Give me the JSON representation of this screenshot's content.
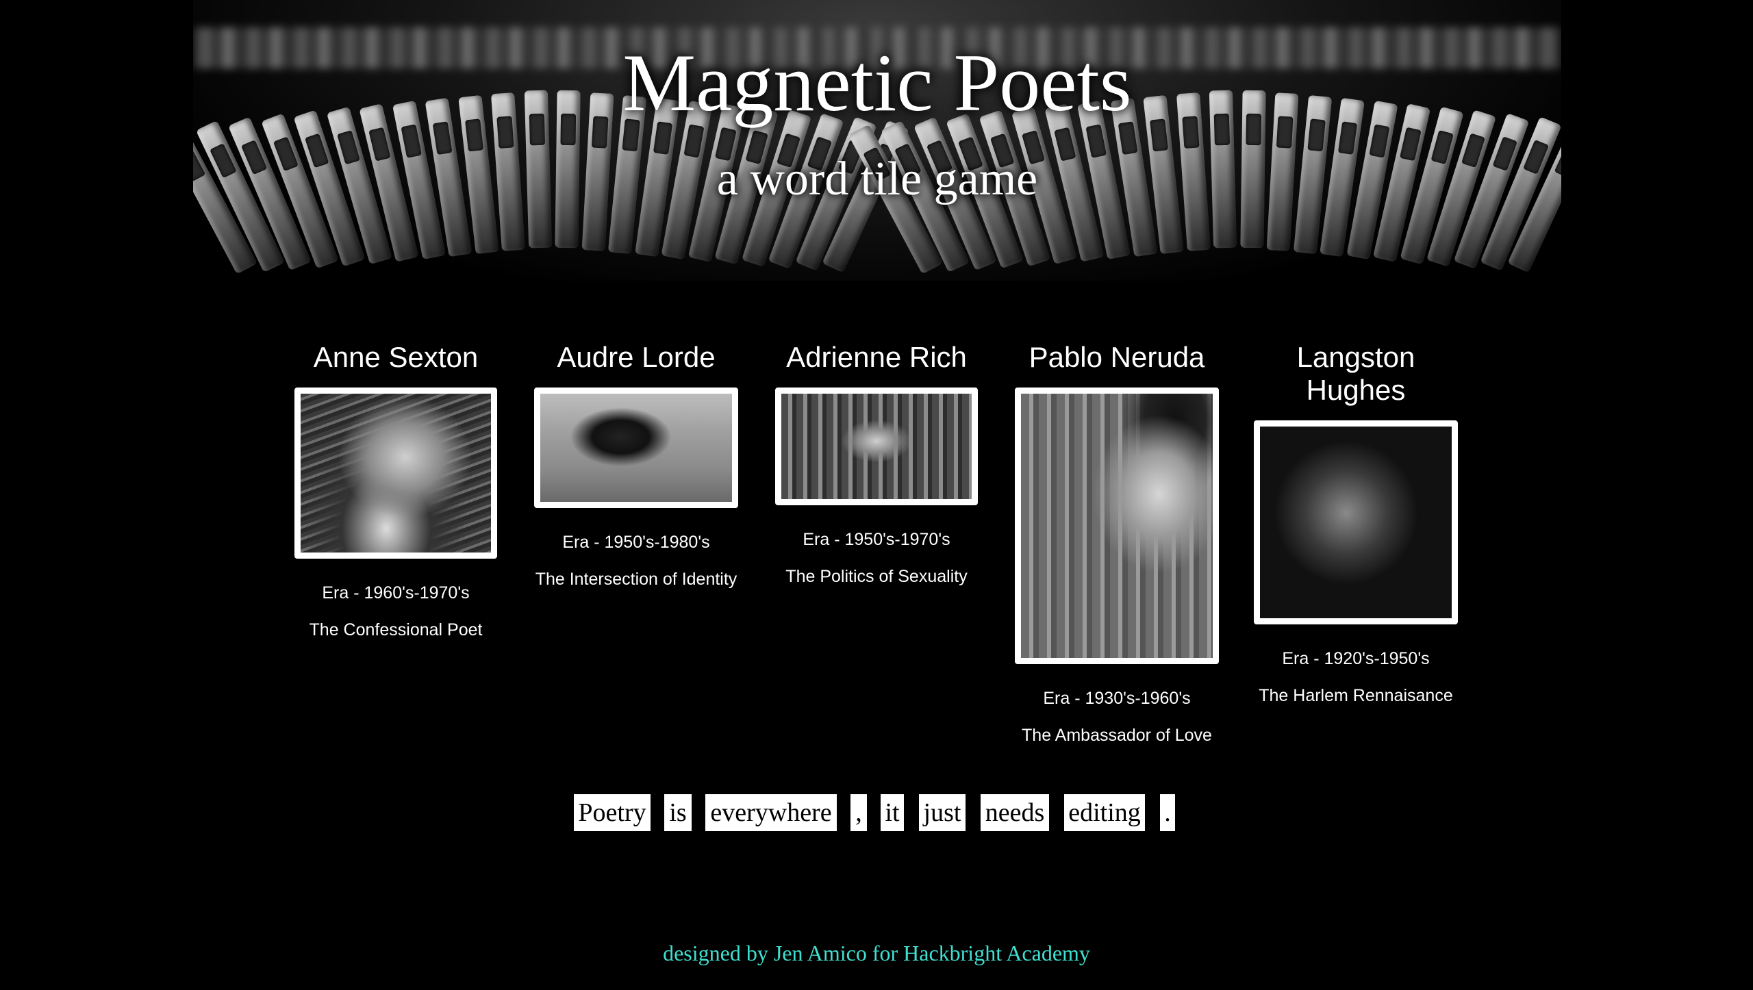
{
  "header": {
    "title": "Magnetic Poets",
    "subtitle": "a word tile game"
  },
  "poets": [
    {
      "name": "Anne Sexton",
      "era": "Era - 1960's-1970's",
      "title": "The Confessional Poet"
    },
    {
      "name": "Audre Lorde",
      "era": "Era - 1950's-1980's",
      "title": "The Intersection of Identity"
    },
    {
      "name": "Adrienne Rich",
      "era": "Era - 1950's-1970's",
      "title": "The Politics of Sexuality"
    },
    {
      "name": "Pablo Neruda",
      "era": "Era - 1930's-1960's",
      "title": "The Ambassador of Love"
    },
    {
      "name": "Langston Hughes",
      "era": "Era - 1920's-1950's",
      "title": "The Harlem Rennaisance"
    }
  ],
  "tiles": [
    "Poetry",
    "is",
    "everywhere",
    ",",
    "it",
    "just",
    "needs",
    "editing",
    "."
  ],
  "footer": {
    "credit": "designed by Jen Amico for Hackbright Academy"
  },
  "colors": {
    "background": "#000000",
    "text": "#ffffff",
    "footer": "#40e0d0",
    "tile_bg": "#ffffff"
  }
}
